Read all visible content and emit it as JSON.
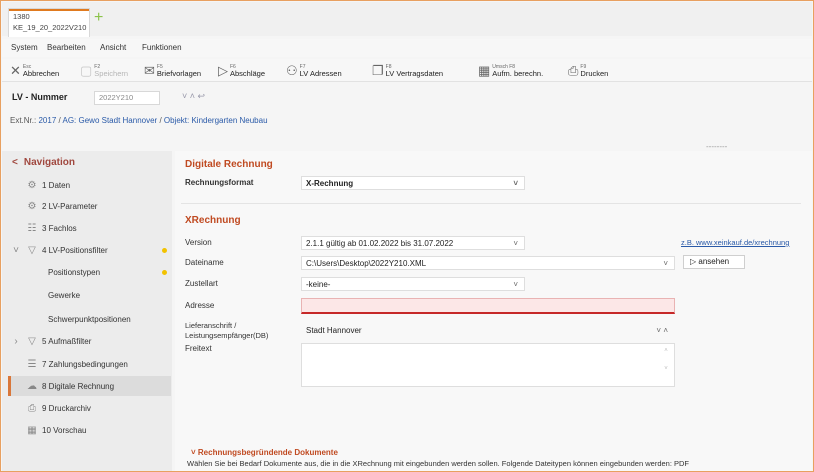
{
  "tab": {
    "line1": "1380",
    "line2": "KE_19_20_2022V210",
    "new_icon": "plus-icon"
  },
  "menu": [
    "System",
    "Bearbeiten",
    "Ansicht",
    "Funktionen"
  ],
  "toolbar": [
    {
      "key": "Esc",
      "label": "Abbrechen",
      "icon": "close-icon",
      "disabled": false
    },
    {
      "key": "F2",
      "label": "Speichern",
      "icon": "save-icon",
      "disabled": true
    },
    {
      "key": "F5",
      "label": "Briefvorlagen",
      "icon": "mail-icon",
      "disabled": false
    },
    {
      "key": "F6",
      "label": "Abschläge",
      "icon": "play-outline-icon",
      "disabled": false
    },
    {
      "key": "F7",
      "label": "LV Adressen",
      "icon": "people-icon",
      "disabled": false
    },
    {
      "key": "F8",
      "label": "LV Vertragsdaten",
      "icon": "document-icon",
      "disabled": false
    },
    {
      "key": "Umsch F8",
      "label": "Aufm. berechn.",
      "icon": "calculator-icon",
      "disabled": false
    },
    {
      "key": "F9",
      "label": "Drucken",
      "icon": "printer-icon",
      "disabled": false
    }
  ],
  "lv": {
    "label": "LV - Nummer",
    "value": "2022Y210",
    "nav_arrows": "˅ ˄ ↩"
  },
  "breadcrumb": {
    "prefix": "Ext.Nr.:",
    "id": "2017",
    "separator": " / ",
    "company": "AG: Gewo Stadt Hannover",
    "object": "Objekt: Kindergarten Neubau"
  },
  "nav": {
    "title": "Navigation",
    "items": [
      {
        "label": "1 Daten",
        "icon": "gear-icon"
      },
      {
        "label": "2 LV-Parameter",
        "icon": "gear-icon"
      },
      {
        "label": "3 Fachlos",
        "icon": "table-icon"
      },
      {
        "label": "4 LV-Positionsfilter",
        "icon": "filter-icon"
      },
      {
        "label": "Positionstypen",
        "icon": ""
      },
      {
        "label": "Gewerke",
        "icon": ""
      },
      {
        "label": "Schwerpunktpositionen",
        "icon": ""
      },
      {
        "label": "5 Aufmaßfilter",
        "icon": "filter-icon"
      },
      {
        "label": "7 Zahlungsbedingungen",
        "icon": "list-icon"
      },
      {
        "label": "8 Digitale Rechnung",
        "icon": "cloud-icon"
      },
      {
        "label": "9 Druckarchiv",
        "icon": "printer-icon"
      },
      {
        "label": "10 Vorschau",
        "icon": "grid-icon"
      }
    ]
  },
  "digital": {
    "title": "Digitale Rechnung",
    "format_label": "Rechnungsformat",
    "format_value": "X-Rechnung"
  },
  "xr": {
    "title": "XRechnung",
    "version_label": "Version",
    "version_value": "2.1.1   gültig ab 01.02.2022 bis 31.07.2022",
    "filename_label": "Dateiname",
    "filename_value": "C:\\Users\\Desktop\\2022Y210.XML",
    "zustell_label": "Zustellart",
    "zustell_value": "-keine-",
    "address_label": "Adresse",
    "address_value": "",
    "liefer_label": "Lieferanschrift /",
    "liefer_label2": "Leistungsempfänger(DB)",
    "liefer_value": "Stadt Hannover",
    "freitext_label": "Freitext",
    "link": "z.B. www.xeinkauf.de/xrechnung",
    "view_button": "ansehen"
  },
  "docs": {
    "title": "Rechnungsbegründende Dokumente",
    "text": "Wählen Sie bei Bedarf Dokumente aus, die in die XRechnung mit eingebunden werden sollen. Folgende Dateitypen können eingebunden werden: PDF"
  },
  "colors": {
    "accent": "#e07a1f",
    "heading": "#c04a21",
    "error": "#c62828",
    "link": "#2a5aa8"
  }
}
